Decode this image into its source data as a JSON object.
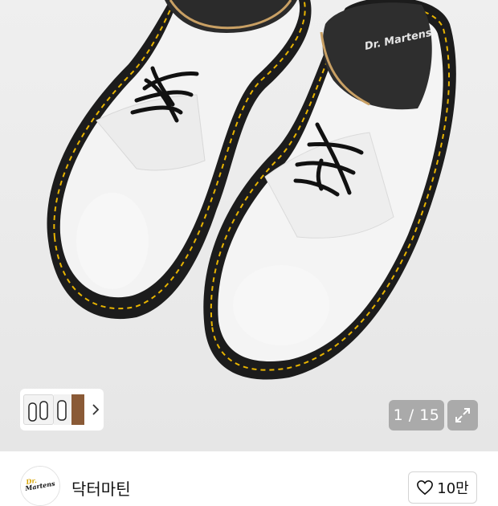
{
  "gallery": {
    "counter_text": "1 / 15",
    "current_index": 1,
    "total_images": 15,
    "thumbnails": [
      {
        "name": "thumb-shoes-pair"
      },
      {
        "name": "thumb-shoe-side"
      },
      {
        "name": "thumb-shoe-brown"
      }
    ],
    "icons": {
      "next": "chevron-right-icon",
      "expand": "expand-arrows-icon"
    }
  },
  "brand": {
    "name": "닥터마틴",
    "logo_lettering": "Dr. Martens"
  },
  "like": {
    "count_text": "10만",
    "icon": "heart-outline-icon"
  },
  "colors": {
    "shoe_upper": "#f4f4f4",
    "sole": "#1c1c1c",
    "stitch": "#e8b400",
    "overlay_button": "#8a8a8a"
  }
}
